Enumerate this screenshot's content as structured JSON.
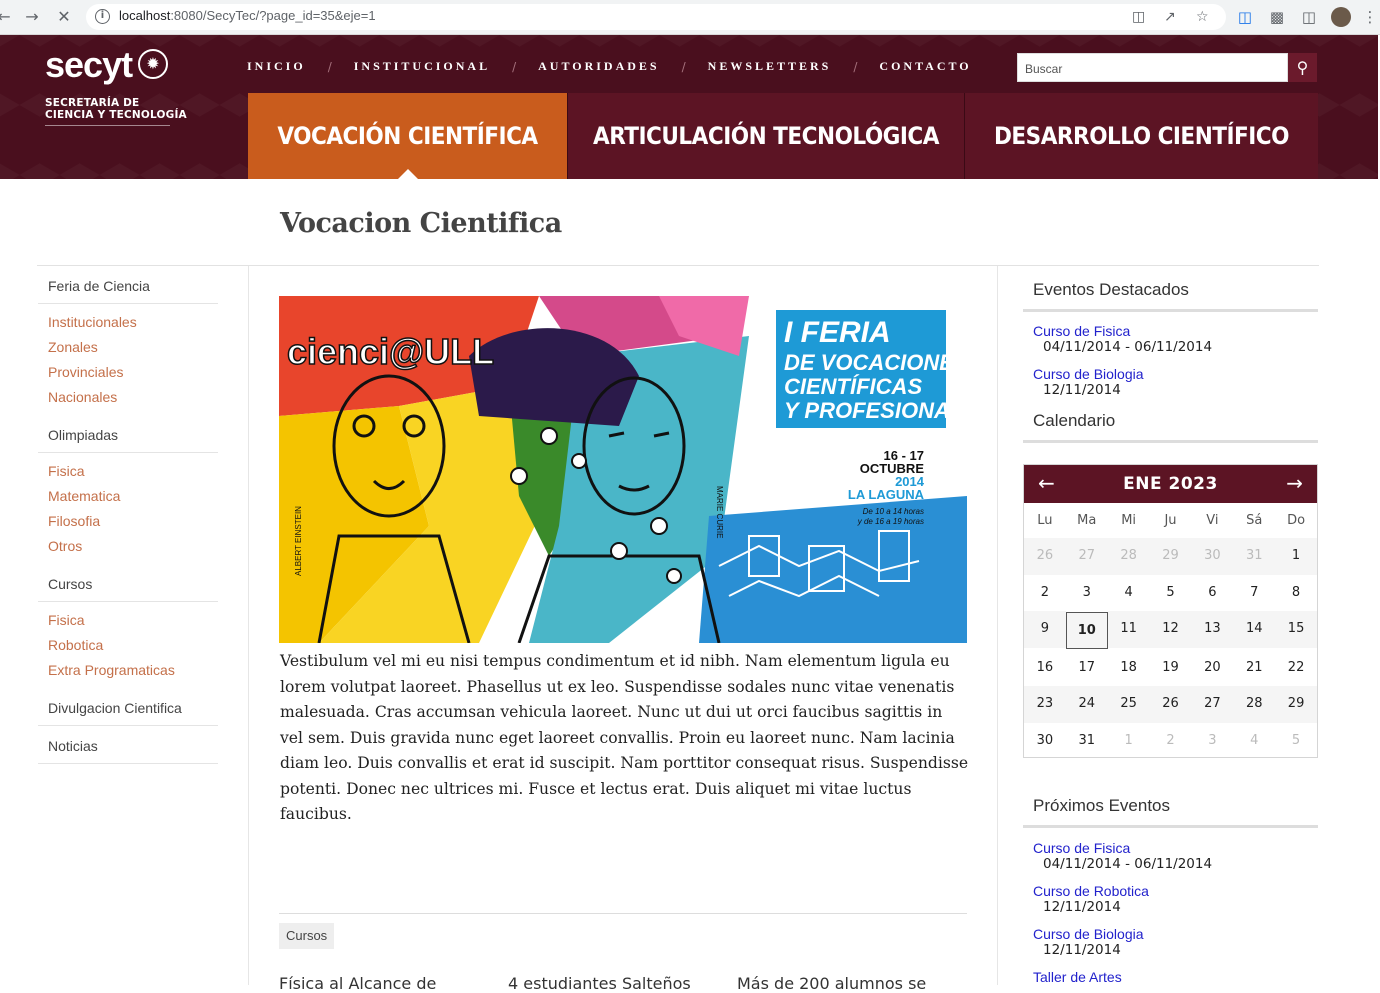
{
  "browser": {
    "url_host": "localhost",
    "url_path": ":8080/SecyTec/?page_id=35&eje=1"
  },
  "header": {
    "logo_word": "secyt",
    "logo_sub_line1": "SECRETARÍA DE",
    "logo_sub_line2": "CIENCIA Y TECNOLOGÍA",
    "nav": [
      "INICIO",
      "INSTITUCIONAL",
      "AUTORIDADES",
      "NEWSLETTERS",
      "CONTACTO"
    ],
    "search_placeholder": "Buscar",
    "pillars": [
      "VOCACIÓN CIENTÍFICA",
      "ARTICULACIÓN TECNOLÓGICA",
      "DESARROLLO CIENTÍFICO"
    ]
  },
  "page_title": "Vocacion Cientifica",
  "sidebar": {
    "groups": [
      {
        "title": "Feria de Ciencia",
        "links": [
          "Institucionales",
          "Zonales",
          "Provinciales",
          "Nacionales"
        ]
      },
      {
        "title": "Olimpiadas",
        "links": [
          "Fisica",
          "Matematica",
          "Filosofia",
          "Otros"
        ]
      },
      {
        "title": "Cursos",
        "links": [
          "Fisica",
          "Robotica",
          "Extra Programaticas"
        ]
      },
      {
        "title": "Divulgacion Cientifica",
        "links": []
      },
      {
        "title": "Noticias",
        "links": []
      }
    ]
  },
  "banner": {
    "brand": "cienci@ULL",
    "title_l1": "I FERIA",
    "title_l2": "DE VOCACIONES",
    "title_l3": "CIENTÍFICAS",
    "title_l4": "Y PROFESIONALES",
    "date_l1": "16 - 17",
    "date_l2": "OCTUBRE",
    "date_l3": "2014",
    "date_l4": "LA LAGUNA",
    "hours_l1": "De 10 a 14 horas",
    "hours_l2": "y de 16 a 19 horas",
    "left_name": "ALBERT EINSTEIN",
    "right_name": "MARIE CURIE"
  },
  "article": {
    "body": "Vestibulum vel mi eu nisi tempus condimentum et id nibh. Nam elementum ligula eu lorem volutpat laoreet. Phasellus ut ex leo. Suspendisse sodales nunc vitae venenatis malesuada. Cras accumsan vehicula laoreet. Nunc ut dui ut orci faucibus sagittis in vel sem. Duis gravida nunc eget laoreet convallis. Proin eu laoreet nunc. Nam lacinia diam leo. Duis convallis et erat id suscipit. Nam porttitor consequat risus. Suspendisse potenti. Donec nec ultrices mi. Fusce et lectus erat. Duis aliquet mi vitae luctus faucibus.",
    "tag": "Cursos",
    "related": [
      "Física al Alcance de",
      "4 estudiantes Salteños",
      "Más de 200 alumnos se"
    ]
  },
  "right": {
    "featured_title": "Eventos Destacados",
    "featured": [
      {
        "title": "Curso de Fisica",
        "date": "04/11/2014 - 06/11/2014"
      },
      {
        "title": "Curso de Biologia",
        "date": "12/11/2014"
      }
    ],
    "calendar_title": "Calendario",
    "calendar": {
      "month": "ENE 2023",
      "day_names": [
        "Lu",
        "Ma",
        "Mi",
        "Ju",
        "Vi",
        "Sá",
        "Do"
      ],
      "weeks": [
        [
          "26",
          "27",
          "28",
          "29",
          "30",
          "31",
          "1"
        ],
        [
          "2",
          "3",
          "4",
          "5",
          "6",
          "7",
          "8"
        ],
        [
          "9",
          "10",
          "11",
          "12",
          "13",
          "14",
          "15"
        ],
        [
          "16",
          "17",
          "18",
          "19",
          "20",
          "21",
          "22"
        ],
        [
          "23",
          "24",
          "25",
          "26",
          "27",
          "28",
          "29"
        ],
        [
          "30",
          "31",
          "1",
          "2",
          "3",
          "4",
          "5"
        ]
      ],
      "today": "10"
    },
    "upcoming_title": "Próximos Eventos",
    "upcoming": [
      {
        "title": "Curso de Fisica",
        "date": "04/11/2014 - 06/11/2014"
      },
      {
        "title": "Curso de Robotica",
        "date": "12/11/2014"
      },
      {
        "title": "Curso de Biologia",
        "date": "12/11/2014"
      },
      {
        "title": "Taller de Artes",
        "date": ""
      }
    ]
  }
}
